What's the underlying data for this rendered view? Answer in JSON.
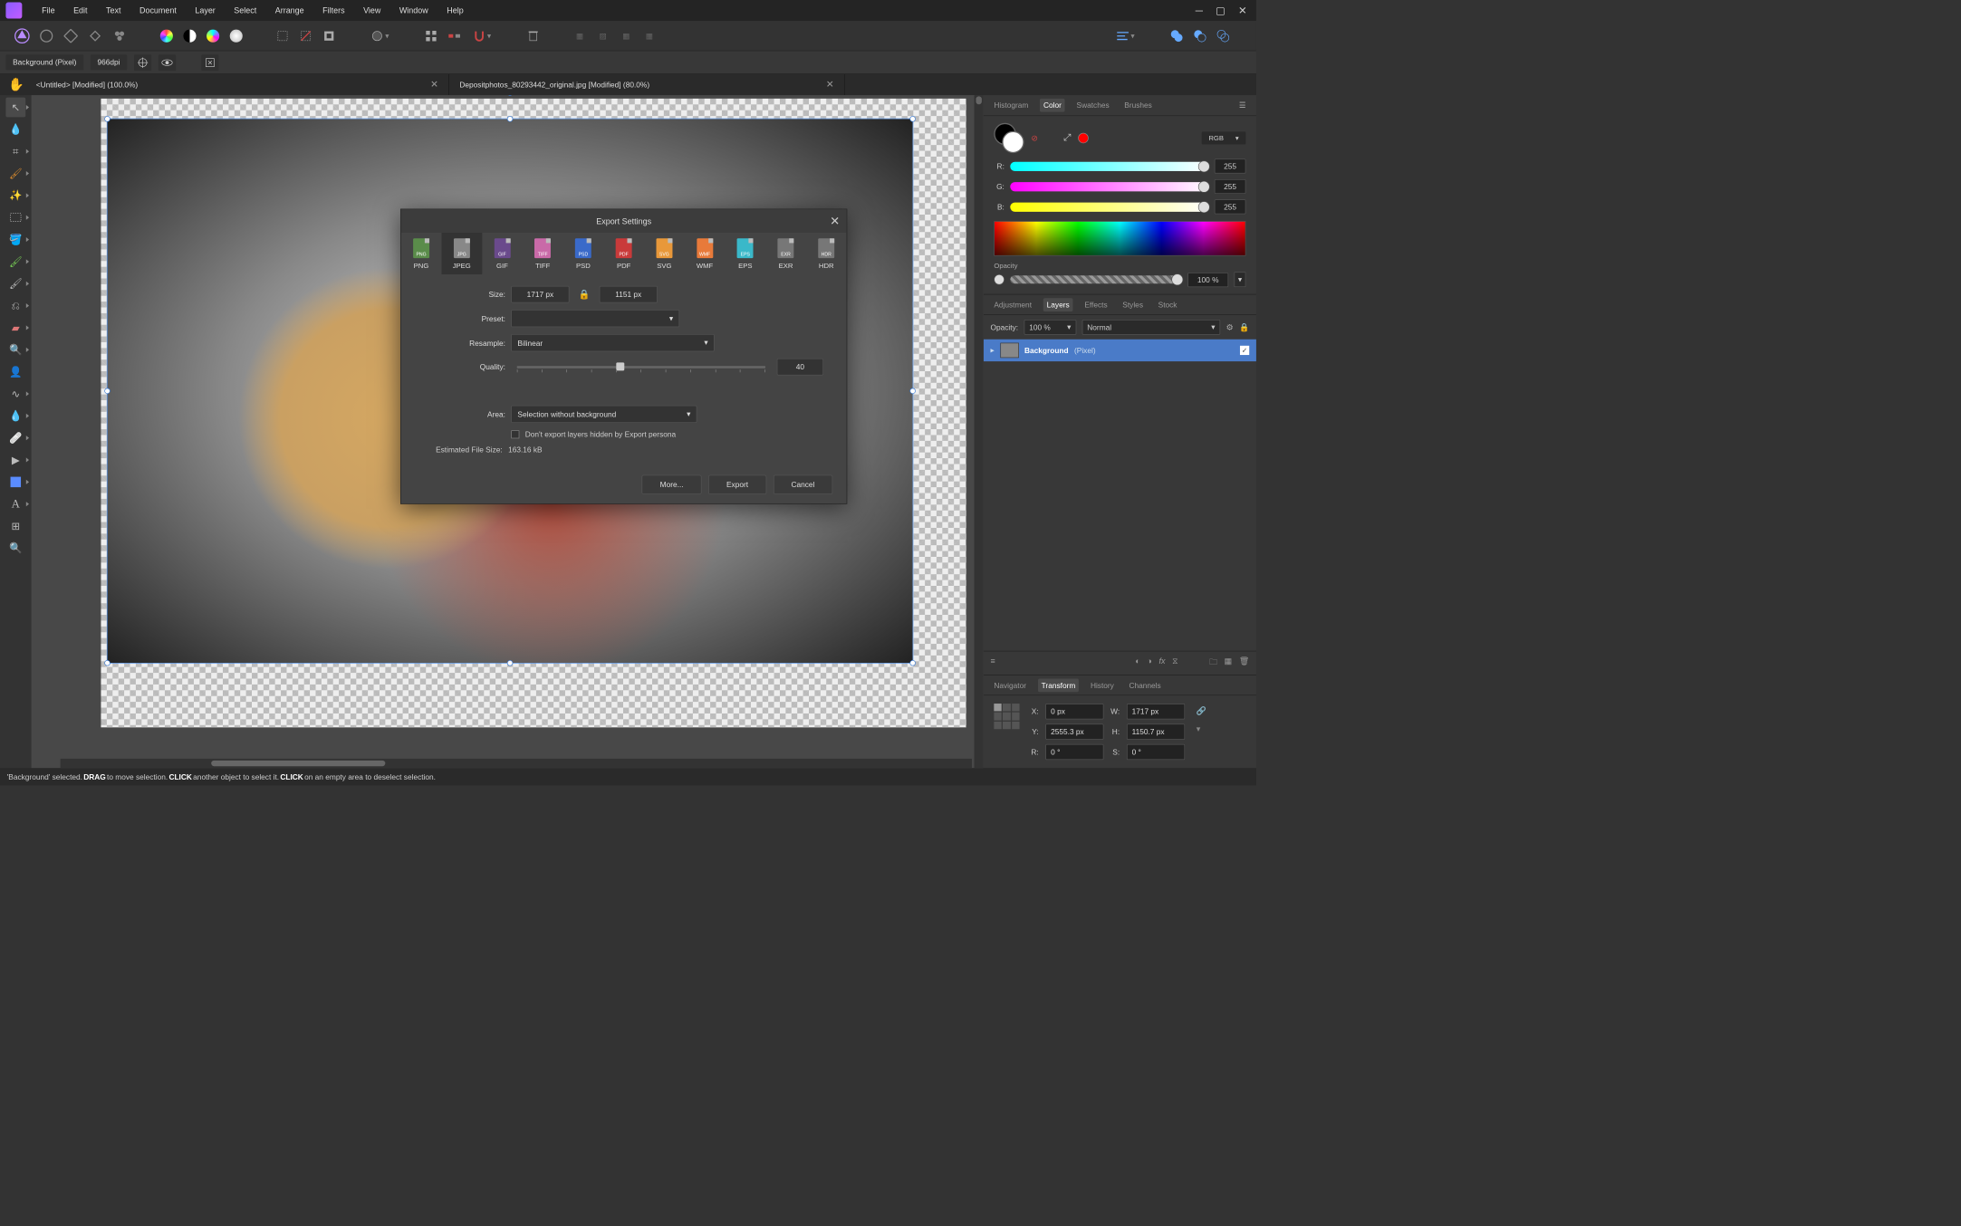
{
  "menu": {
    "items": [
      "File",
      "Edit",
      "Text",
      "Document",
      "Layer",
      "Select",
      "Arrange",
      "Filters",
      "View",
      "Window",
      "Help"
    ]
  },
  "context": {
    "layer_info": "Background (Pixel)",
    "dpi": "966dpi"
  },
  "tabs": [
    {
      "title": "<Untitled> [Modified] (100.0%)"
    },
    {
      "title": "Depositphotos_80293442_original.jpg [Modified] (80.0%)"
    }
  ],
  "panels": {
    "top_tabs": [
      "Histogram",
      "Color",
      "Swatches",
      "Brushes"
    ],
    "top_active": "Color",
    "color": {
      "mode": "RGB",
      "r": "255",
      "g": "255",
      "b": "255",
      "opacity_label": "Opacity",
      "opacity": "100 %"
    },
    "mid_tabs": [
      "Adjustment",
      "Layers",
      "Effects",
      "Styles",
      "Stock"
    ],
    "mid_active": "Layers",
    "layers": {
      "opacity_label": "Opacity:",
      "opacity": "100 %",
      "blend": "Normal",
      "item_name": "Background",
      "item_type": "(Pixel)"
    },
    "bottom_tabs": [
      "Navigator",
      "Transform",
      "History",
      "Channels"
    ],
    "bottom_active": "Transform",
    "transform": {
      "x_lbl": "X:",
      "x": "0 px",
      "y_lbl": "Y:",
      "y": "2555.3 px",
      "w_lbl": "W:",
      "w": "1717 px",
      "h_lbl": "H:",
      "h": "1150.7 px",
      "r_lbl": "R:",
      "r": "0 °",
      "s_lbl": "S:",
      "s": "0 °"
    }
  },
  "dialog": {
    "title": "Export Settings",
    "formats": [
      "PNG",
      "JPEG",
      "GIF",
      "TIFF",
      "PSD",
      "PDF",
      "SVG",
      "WMF",
      "EPS",
      "EXR",
      "HDR"
    ],
    "selected_format": "JPEG",
    "size_lbl": "Size:",
    "size_w": "1717 px",
    "size_h": "1151 px",
    "preset_lbl": "Preset:",
    "preset": "",
    "resample_lbl": "Resample:",
    "resample": "Bilinear",
    "quality_lbl": "Quality:",
    "quality": "40",
    "area_lbl": "Area:",
    "area": "Selection without background",
    "hide_layers_chk": "Don't export layers hidden by Export persona",
    "est_lbl": "Estimated File Size:",
    "est_val": "163.16 kB",
    "btn_more": "More...",
    "btn_export": "Export",
    "btn_cancel": "Cancel"
  },
  "status": {
    "p1": "'Background' selected. ",
    "b1": "DRAG",
    "p2": " to move selection. ",
    "b2": "CLICK",
    "p3": " another object to select it. ",
    "b3": "CLICK",
    "p4": " on an empty area to deselect selection."
  }
}
